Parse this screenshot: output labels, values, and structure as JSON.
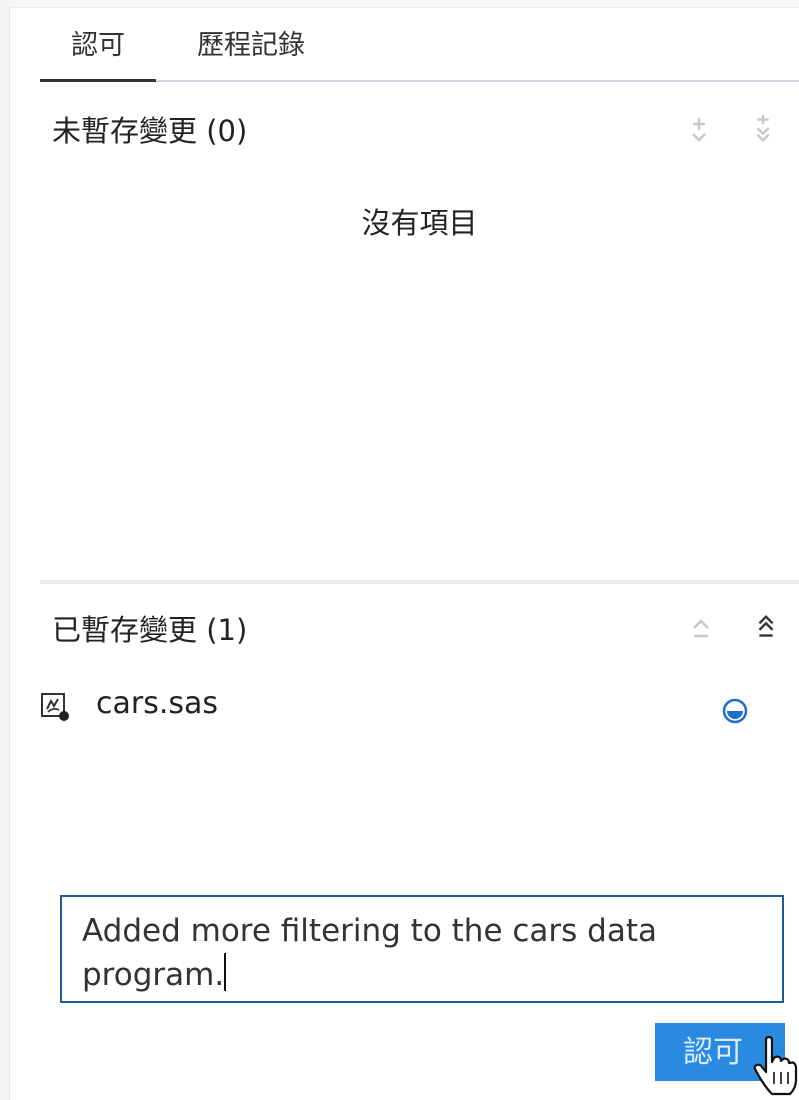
{
  "tabs": [
    {
      "label": "認可",
      "active": true
    },
    {
      "label": "歷程記錄",
      "active": false
    }
  ],
  "unstaged": {
    "title": "未暫存變更 (0)",
    "empty_text": "沒有項目",
    "actions": [
      "stage-icon",
      "stage-all-icon"
    ]
  },
  "staged": {
    "title": "已暫存變更 (1)",
    "actions": [
      "collapse-icon",
      "collapse-all-icon"
    ],
    "files": [
      {
        "name": "cars.sas",
        "icon": "sas-program-file-icon",
        "action_icon": "unstage-icon"
      }
    ]
  },
  "commit": {
    "message": "Added more filtering to the cars data program.",
    "button_label": "認可"
  },
  "colors": {
    "accent": "#2a8ae0",
    "input_border": "#1f5a9a",
    "disabled_icon": "#c8c8c8"
  }
}
